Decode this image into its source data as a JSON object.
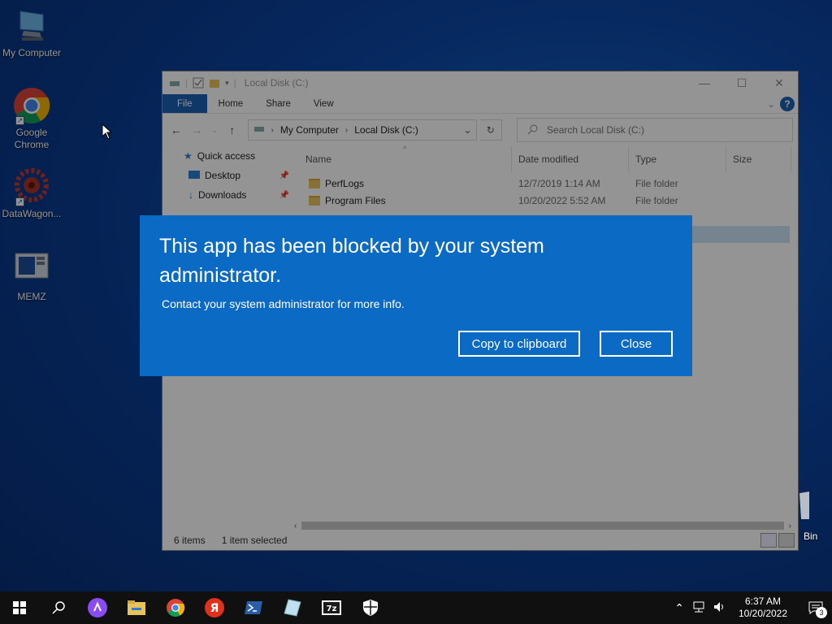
{
  "desktop": {
    "icons": [
      {
        "label": "My Computer"
      },
      {
        "label": "Google Chrome"
      },
      {
        "label": "DataWagon..."
      },
      {
        "label": "MEMZ"
      }
    ],
    "recycle_label": "Bin"
  },
  "explorer": {
    "title": "Local Disk (C:)",
    "ribbon": {
      "file": "File",
      "home": "Home",
      "share": "Share",
      "view": "View",
      "help": "?"
    },
    "address": {
      "root": "My Computer",
      "current": "Local Disk (C:)"
    },
    "search_placeholder": "Search Local Disk (C:)",
    "sidebar": [
      {
        "label": "Quick access"
      },
      {
        "label": "Desktop"
      },
      {
        "label": "Downloads"
      }
    ],
    "columns": {
      "name": "Name",
      "date": "Date modified",
      "type": "Type",
      "size": "Size"
    },
    "rows": [
      {
        "name": "PerfLogs",
        "date": "12/7/2019 1:14 AM",
        "type": "File folder"
      },
      {
        "name": "Program Files",
        "date": "10/20/2022 5:52 AM",
        "type": "File folder"
      }
    ],
    "status": {
      "items": "6 items",
      "selected": "1 item selected"
    }
  },
  "dialog": {
    "title": "This app has been blocked by your system administrator.",
    "message": "Contact your system administrator for more info.",
    "copy_label": "Copy to clipboard",
    "close_label": "Close",
    "bg_color": "#0b6ac4"
  },
  "taskbar": {
    "time": "6:37 AM",
    "date": "10/20/2022",
    "notifications": "3"
  }
}
